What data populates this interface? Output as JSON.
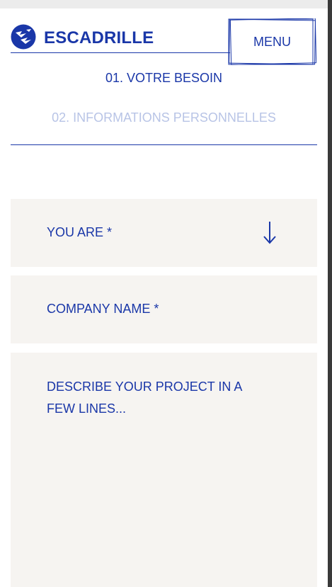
{
  "header": {
    "brand": "ESCADRILLE",
    "logo_icon": "bird-flock-icon",
    "menu_label": "MENU"
  },
  "steps": {
    "step1": "01. VOTRE BESOIN",
    "step2": "02. INFORMATIONS PERSONNELLES",
    "active_color": "#1a37a8",
    "inactive_color": "#b8c4e6"
  },
  "form": {
    "you_are": {
      "label": "YOU ARE *",
      "icon": "arrow-down-icon"
    },
    "company": {
      "label": "COMPANY NAME *"
    },
    "project": {
      "label": "DESCRIBE YOUR PROJECT IN A FEW LINES..."
    }
  },
  "colors": {
    "brand": "#1a37a8",
    "field_bg": "#f6f4f1",
    "page_bg": "#ffffff"
  }
}
